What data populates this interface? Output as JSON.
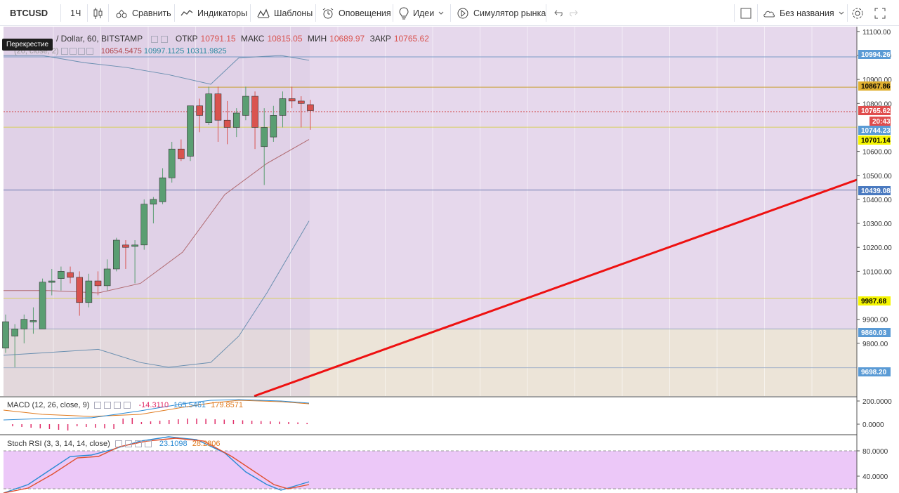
{
  "toolbar": {
    "symbol": "BTCUSD",
    "interval": "1Ч",
    "compare": "Сравнить",
    "indicators": "Индикаторы",
    "templates": "Шаблоны",
    "alerts": "Оповещения",
    "ideas": "Идеи",
    "simulator": "Симулятор рынка",
    "layout_name": "Без названия"
  },
  "tooltip": "Перекрестие",
  "legend": {
    "title": "/ Dollar, 60, BITSTAMP",
    "open_label": "ОТКР",
    "open": "10791.15",
    "high_label": "МАКС",
    "high": "10815.05",
    "low_label": "МИН",
    "low": "10689.97",
    "close_label": "ЗАКР",
    "close": "10765.62",
    "bb_name": "(20, close, 2)",
    "bb_basis": "10654.5475",
    "bb_upper": "10997.1125",
    "bb_lower": "10311.9825"
  },
  "macd_legend": {
    "name": "MACD (12, 26, close, 9)",
    "hist": "-14.3110",
    "macd": "165.5461",
    "signal": "179.8571"
  },
  "rsi_legend": {
    "name": "Stoch RSI (3, 3, 14, 14, close)",
    "k": "23.1098",
    "d": "28.2806"
  },
  "price_scale": {
    "ticks": [
      "11100.00",
      "11000.00",
      "10900.00",
      "10800.00",
      "10600.00",
      "10500.00",
      "10400.00",
      "10300.00",
      "10200.00",
      "10100.00",
      "9900.00",
      "9800.00"
    ],
    "tags": [
      {
        "text": "10994.26",
        "bg": "#5b9bd5",
        "fg": "#ffffff"
      },
      {
        "text": "10867.86",
        "bg": "#e0b030",
        "fg": "#000000"
      },
      {
        "text": "10765.62",
        "bg": "#e04c4c",
        "fg": "#ffffff"
      },
      {
        "text": "20:43",
        "bg": "#e04c4c",
        "fg": "#ffffff"
      },
      {
        "text": "10744.23",
        "bg": "#5b9bd5",
        "fg": "#ffffff"
      },
      {
        "text": "10701.14",
        "bg": "#f5f500",
        "fg": "#000000"
      },
      {
        "text": "10439.08",
        "bg": "#4a7ac0",
        "fg": "#ffffff"
      },
      {
        "text": "9987.68",
        "bg": "#f5f500",
        "fg": "#000000"
      },
      {
        "text": "9860.03",
        "bg": "#5b9bd5",
        "fg": "#ffffff"
      },
      {
        "text": "9698.20",
        "bg": "#5b9bd5",
        "fg": "#ffffff"
      }
    ]
  },
  "macd_scale": {
    "ticks": [
      "200.0000",
      "0.0000"
    ]
  },
  "rsi_scale": {
    "ticks": [
      "80.0000",
      "40.0000"
    ]
  },
  "colors": {
    "up": "#5a9e72",
    "down": "#d9534f",
    "purple_zone": "#e6d8ec",
    "beige_zone": "#ece4d8",
    "rsi_band": "#ecc8f8",
    "trend_line": "#ee1111"
  },
  "chart_data": {
    "type": "candlestick",
    "interval": "60",
    "price_range": [
      9580,
      11100
    ],
    "candles": [
      {
        "o": 9780,
        "h": 9920,
        "l": 9760,
        "c": 9890
      },
      {
        "o": 9830,
        "h": 9880,
        "l": 9700,
        "c": 9860
      },
      {
        "o": 9860,
        "h": 9920,
        "l": 9800,
        "c": 9900
      },
      {
        "o": 9890,
        "h": 9950,
        "l": 9840,
        "c": 9895
      },
      {
        "o": 9860,
        "h": 10070,
        "l": 9860,
        "c": 10055
      },
      {
        "o": 10055,
        "h": 10110,
        "l": 10000,
        "c": 10060
      },
      {
        "o": 10070,
        "h": 10120,
        "l": 10020,
        "c": 10100
      },
      {
        "o": 10095,
        "h": 10120,
        "l": 10050,
        "c": 10075
      },
      {
        "o": 10075,
        "h": 10100,
        "l": 9915,
        "c": 9970
      },
      {
        "o": 9970,
        "h": 10090,
        "l": 9950,
        "c": 10060
      },
      {
        "o": 10060,
        "h": 10100,
        "l": 10000,
        "c": 10040
      },
      {
        "o": 10040,
        "h": 10150,
        "l": 10020,
        "c": 10110
      },
      {
        "o": 10110,
        "h": 10240,
        "l": 10100,
        "c": 10230
      },
      {
        "o": 10210,
        "h": 10230,
        "l": 10110,
        "c": 10200
      },
      {
        "o": 10205,
        "h": 10230,
        "l": 10050,
        "c": 10210
      },
      {
        "o": 10210,
        "h": 10400,
        "l": 10190,
        "c": 10380
      },
      {
        "o": 10380,
        "h": 10410,
        "l": 10300,
        "c": 10400
      },
      {
        "o": 10390,
        "h": 10530,
        "l": 10380,
        "c": 10490
      },
      {
        "o": 10490,
        "h": 10640,
        "l": 10470,
        "c": 10610
      },
      {
        "o": 10610,
        "h": 10650,
        "l": 10560,
        "c": 10570
      },
      {
        "o": 10580,
        "h": 10790,
        "l": 10560,
        "c": 10790
      },
      {
        "o": 10790,
        "h": 10820,
        "l": 10680,
        "c": 10750
      },
      {
        "o": 10720,
        "h": 10870,
        "l": 10710,
        "c": 10840
      },
      {
        "o": 10840,
        "h": 10870,
        "l": 10640,
        "c": 10730
      },
      {
        "o": 10730,
        "h": 10810,
        "l": 10630,
        "c": 10700
      },
      {
        "o": 10700,
        "h": 10780,
        "l": 10660,
        "c": 10760
      },
      {
        "o": 10750,
        "h": 10870,
        "l": 10730,
        "c": 10830
      },
      {
        "o": 10830,
        "h": 10850,
        "l": 10610,
        "c": 10700
      },
      {
        "o": 10620,
        "h": 10780,
        "l": 10460,
        "c": 10700
      },
      {
        "o": 10660,
        "h": 10790,
        "l": 10640,
        "c": 10750
      },
      {
        "o": 10750,
        "h": 10850,
        "l": 10700,
        "c": 10820
      },
      {
        "o": 10820,
        "h": 10870,
        "l": 10780,
        "c": 10810
      },
      {
        "o": 10810,
        "h": 10830,
        "l": 10700,
        "c": 10800
      },
      {
        "o": 10795,
        "h": 10815,
        "l": 10690,
        "c": 10770
      }
    ],
    "horizontal_levels": [
      10994.26,
      10867.86,
      10765.62,
      10701.14,
      10439.08,
      9987.68,
      9860.03,
      9698.2
    ],
    "trend_line": {
      "from": [
        31,
        9600
      ],
      "to": [
        105,
        10480
      ]
    }
  }
}
